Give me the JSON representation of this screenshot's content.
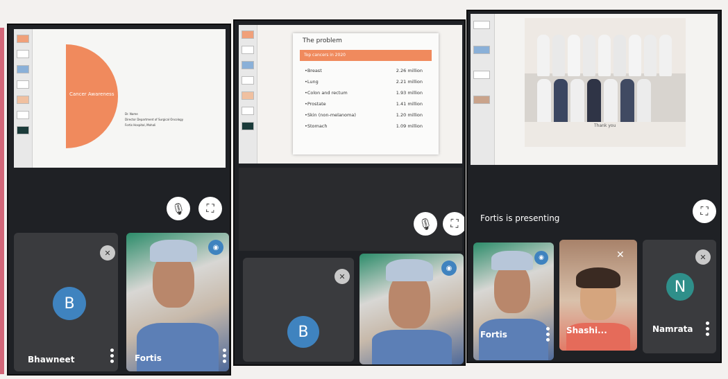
{
  "screens": [
    {
      "slide": {
        "title": "Cancer Awareness",
        "lines": [
          "Dr. Name",
          "Director Department of Surgical Oncology",
          "Fortis Hospital, Mohali"
        ]
      },
      "tiles": [
        {
          "initial": "B",
          "name": "Bhawneet",
          "avatar_color": "#3f83bf"
        },
        {
          "name": "Fortis"
        }
      ]
    },
    {
      "slide": {
        "title": "The problem",
        "header_row": "Top cancers in 2020",
        "rows": [
          {
            "label": "•Breast",
            "value": "2.26 million"
          },
          {
            "label": "•Lung",
            "value": "2.21 million"
          },
          {
            "label": "•Colon and rectum",
            "value": "1.93 million"
          },
          {
            "label": "•Prostate",
            "value": "1.41 million"
          },
          {
            "label": "•Skin (non-melanoma)",
            "value": "1.20 million"
          },
          {
            "label": "•Stomach",
            "value": "1.09 million"
          }
        ]
      },
      "tiles": [
        {
          "initial": "B",
          "avatar_color": "#3f83bf"
        },
        {
          "name": ""
        }
      ]
    },
    {
      "slide": {
        "caption": "Thank you"
      },
      "presenting_text": "Fortis is presenting",
      "tiles": [
        {
          "name": "Fortis"
        },
        {
          "name": "Shashi..."
        },
        {
          "initial": "N",
          "name": "Namrata",
          "avatar_color": "#2f8f8a"
        }
      ]
    }
  ],
  "icons": {
    "mic": "mic-icon",
    "fullscreen": "fullscreen-icon",
    "muted": "mic-off-icon",
    "more": "more-vert-icon",
    "pin": "pin-icon"
  },
  "colors": {
    "accent_orange": "#f08a5d",
    "meet_bg": "#1f2125",
    "tile_bg": "#3a3b3e"
  }
}
